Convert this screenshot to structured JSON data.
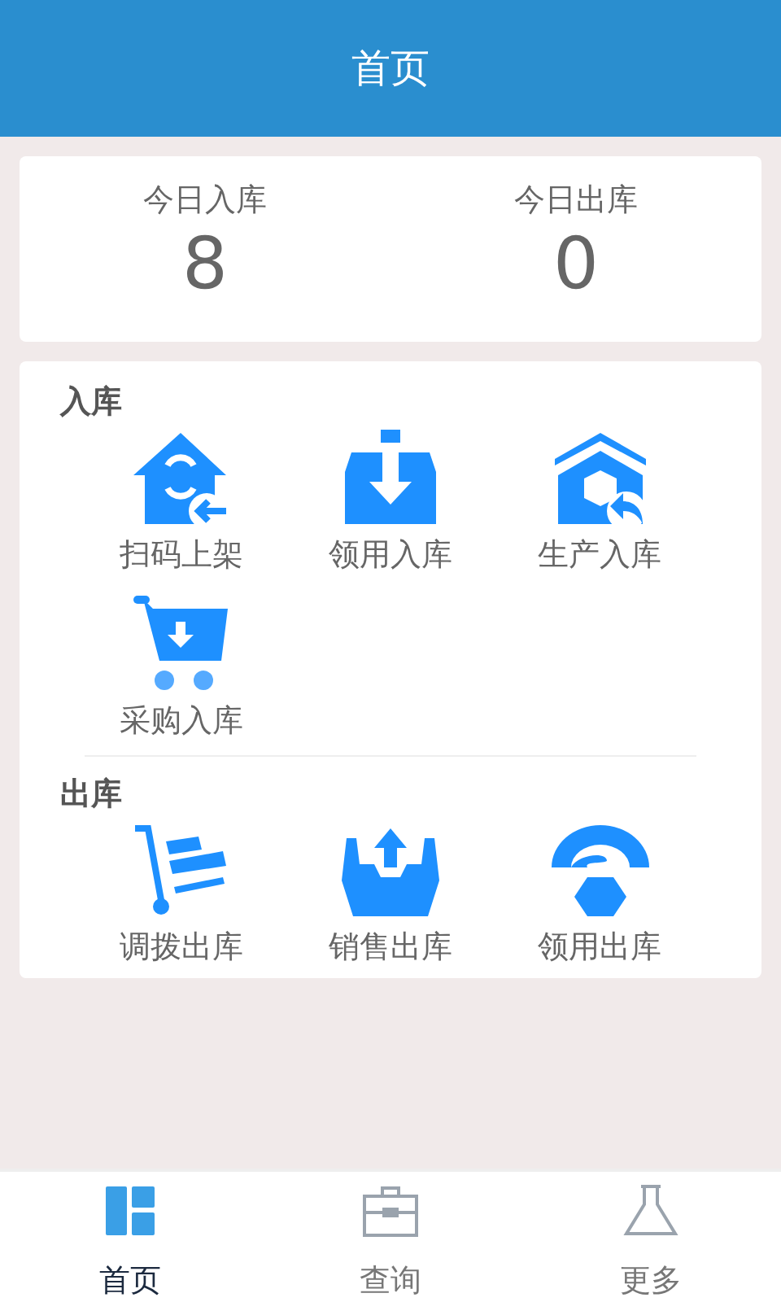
{
  "header": {
    "title": "首页"
  },
  "stats": [
    {
      "label": "今日入库",
      "value": "8"
    },
    {
      "label": "今日出库",
      "value": "0"
    }
  ],
  "sections": [
    {
      "title": "入库",
      "items": [
        {
          "label": "扫码上架",
          "kind": "scan"
        },
        {
          "label": "领用入库",
          "kind": "boxin"
        },
        {
          "label": "生产入库",
          "kind": "produce"
        },
        {
          "label": "采购入库",
          "kind": "cart"
        }
      ]
    },
    {
      "title": "出库",
      "items": [
        {
          "label": "调拨出库",
          "kind": "trolley"
        },
        {
          "label": "销售出库",
          "kind": "trayout"
        },
        {
          "label": "领用出库",
          "kind": "handout"
        }
      ]
    }
  ],
  "tabs": [
    {
      "label": "首页",
      "kind": "home",
      "selected": true
    },
    {
      "label": "查询",
      "kind": "case",
      "selected": false
    },
    {
      "label": "更多",
      "kind": "flask",
      "selected": false
    }
  ]
}
